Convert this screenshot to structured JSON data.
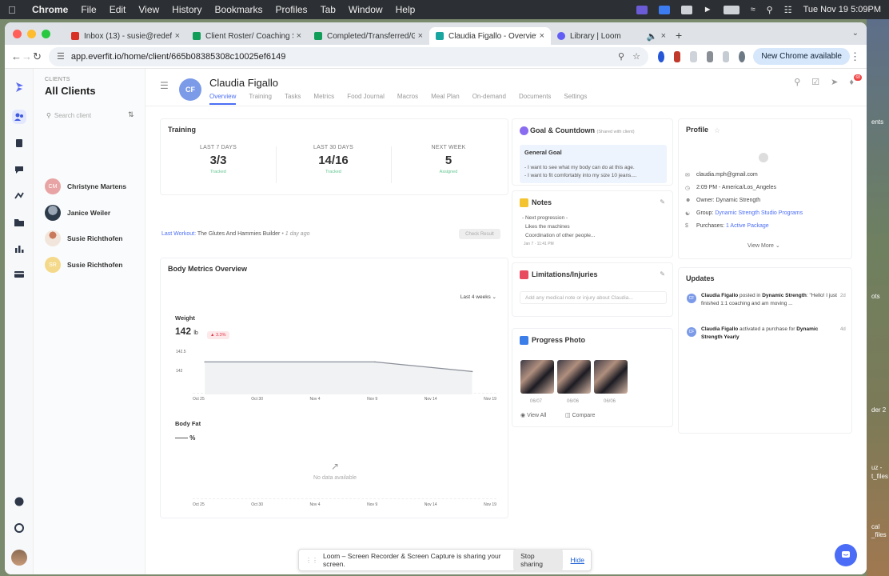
{
  "menubar": {
    "app": "Chrome",
    "items": [
      "File",
      "Edit",
      "View",
      "History",
      "Bookmarks",
      "Profiles",
      "Tab",
      "Window",
      "Help"
    ],
    "datetime": "Tue Nov 19  5:09PM"
  },
  "tabs": [
    {
      "title": "Inbox (13) - susie@redefining",
      "color": "#d93025"
    },
    {
      "title": "Client Roster/ Coaching Sh",
      "color": "#0f9d58"
    },
    {
      "title": "Completed/Transferred/Ghos",
      "color": "#0f9d58"
    },
    {
      "title": "Claudia Figallo - Overview - E",
      "color": "#1aa6a0"
    },
    {
      "title": "Library | Loom",
      "color": "#625df5"
    }
  ],
  "address": {
    "url": "app.everfit.io/home/client/665b08385308c10025ef6149",
    "new_chrome": "New Chrome available"
  },
  "clients_panel": {
    "subtitle": "CLIENTS",
    "title": "All Clients",
    "search_placeholder": "Search client",
    "clients": [
      {
        "initials": "CM",
        "name": "Christyne Martens",
        "color": "#e8a4a4"
      },
      {
        "initials": "",
        "name": "Janice Weiler",
        "color": "#2d3a4a"
      },
      {
        "initials": "",
        "name": "Susie Richthofen",
        "color": "#e8d0c4"
      },
      {
        "initials": "SR",
        "name": "Susie Richthofen",
        "color": "#f4d98a"
      }
    ]
  },
  "client_header": {
    "initials": "CF",
    "name": "Claudia Figallo",
    "tabs": [
      "Overview",
      "Training",
      "Tasks",
      "Metrics",
      "Food Journal",
      "Macros",
      "Meal Plan",
      "On-demand",
      "Documents",
      "Settings"
    ],
    "notification_count": "68"
  },
  "training": {
    "title": "Training",
    "stats": [
      {
        "label": "LAST 7 DAYS",
        "value": "3/3",
        "sub": "Tracked"
      },
      {
        "label": "LAST 30 DAYS",
        "value": "14/16",
        "sub": "Tracked"
      },
      {
        "label": "NEXT WEEK",
        "value": "5",
        "sub": "Assigned"
      }
    ],
    "last_workout_label": "Last Workout:",
    "last_workout": "The Glutes And Hammies Builder",
    "last_workout_ago": "• 1 day ago",
    "check_result": "Check Result"
  },
  "body_metrics": {
    "title": "Body Metrics Overview",
    "range": "Last 4 weeks",
    "weight_label": "Weight",
    "weight_value": "142",
    "weight_unit": "lb",
    "weight_change": "▲ 3.3%",
    "bodyfat_label": "Body Fat",
    "bodyfat_value": "—— %",
    "no_data": "No data available"
  },
  "chart_data": [
    {
      "type": "area",
      "title": "Weight",
      "x": [
        "Oct 25",
        "Oct 30",
        "Nov 4",
        "Nov 9",
        "Nov 14",
        "Nov 19"
      ],
      "yticks": [
        "142.5",
        "142"
      ],
      "series": [
        {
          "points": [
            [
              "Oct 26",
              142.2
            ],
            [
              "Nov 9",
              142.2
            ],
            [
              "Nov 17",
              141.95
            ]
          ]
        }
      ]
    },
    {
      "type": "area",
      "title": "Body Fat",
      "x": [
        "Oct 25",
        "Oct 30",
        "Nov 4",
        "Nov 9",
        "Nov 14",
        "Nov 19"
      ],
      "series": []
    }
  ],
  "goal": {
    "title": "Goal & Countdown",
    "shared": "(Shared with client)",
    "heading": "General Goal",
    "lines": [
      "- I want to see what my body can do at this age.",
      "- I want to fit comfortably into my size 10 jeans...."
    ]
  },
  "notes": {
    "title": "Notes",
    "lines": [
      "- Next progression -",
      "Likes the machines",
      "Coordination of other people..."
    ],
    "date": "Jan 7 · 11:41 PM"
  },
  "limitations": {
    "title": "Limitations/Injuries",
    "placeholder": "Add any medical note or injury about Claudia..."
  },
  "progress_photo": {
    "title": "Progress Photo",
    "dates": [
      "06/07",
      "06/06",
      "06/06"
    ],
    "view_all": "View All",
    "compare": "Compare"
  },
  "profile": {
    "title": "Profile",
    "email": "claudia.mph@gmail.com",
    "time": "2:09 PM - America/Los_Angeles",
    "owner": "Owner: Dynamic Strength",
    "group_label": "Group: ",
    "group": "Dynamic Strength Studio Programs",
    "purchases_label": "Purchases: ",
    "purchases": "1 Active Package",
    "view_more": "View More"
  },
  "updates": {
    "title": "Updates",
    "items": [
      {
        "name": "Claudia Figallo",
        "action": " posted in ",
        "target": "Dynamic Strength",
        "text": ": \"Hello! I just finished 1:1 coaching and am moving ...",
        "ago": "2d"
      },
      {
        "name": "Claudia Figallo",
        "action": " activated a purchase for ",
        "target": "Dynamic Strength Yearly",
        "text": "",
        "ago": "4d"
      }
    ]
  },
  "loom_bar": {
    "message": "Loom – Screen Recorder & Screen Capture is sharing your screen.",
    "stop": "Stop sharing",
    "hide": "Hide"
  },
  "desktop": {
    "labels": [
      "ents",
      "ots",
      "der 2",
      "uz -",
      "t_files",
      "cal",
      "_files"
    ]
  }
}
